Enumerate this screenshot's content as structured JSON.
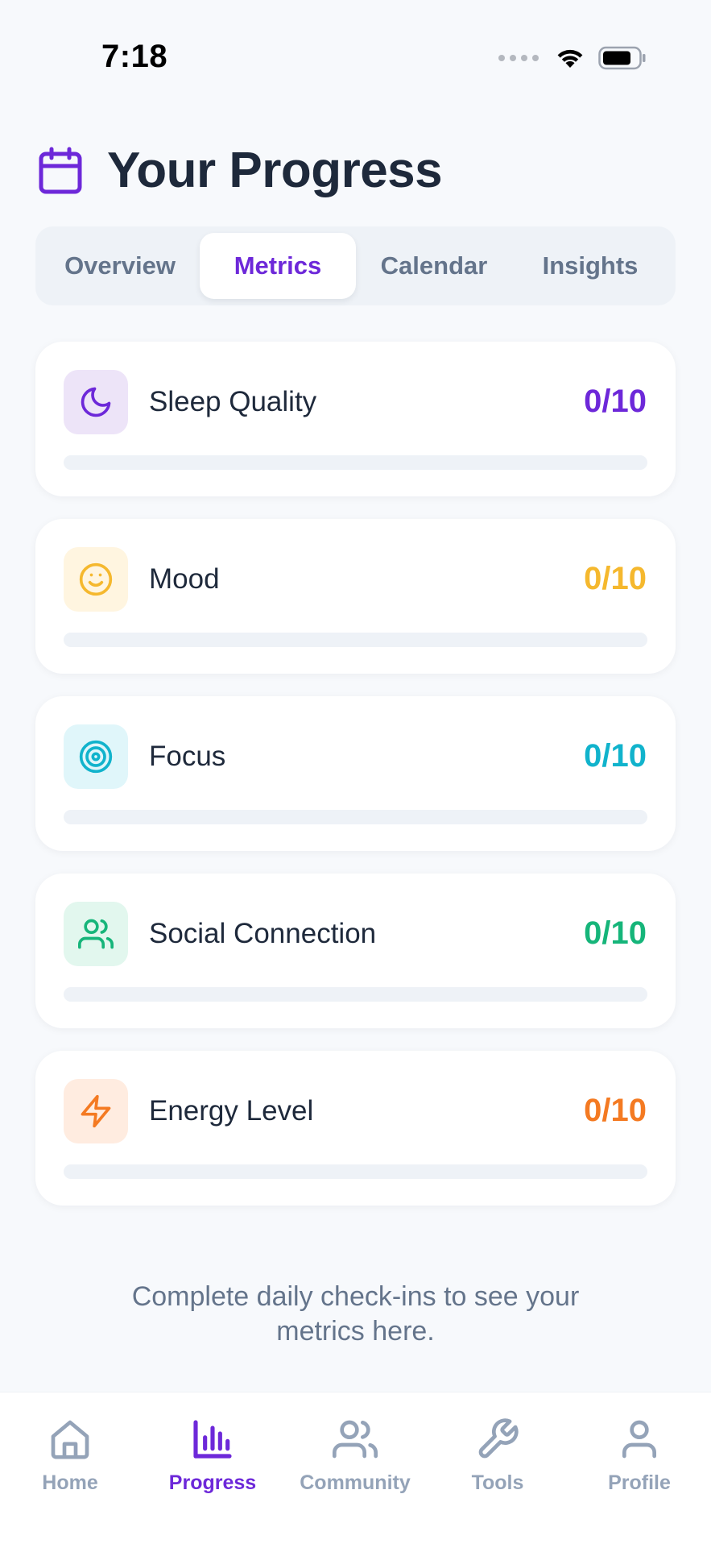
{
  "status_bar": {
    "time": "7:18"
  },
  "header": {
    "title": "Your Progress",
    "icon": "calendar-icon"
  },
  "tabs": [
    {
      "label": "Overview",
      "active": false
    },
    {
      "label": "Metrics",
      "active": true
    },
    {
      "label": "Calendar",
      "active": false
    },
    {
      "label": "Insights",
      "active": false
    }
  ],
  "metrics": [
    {
      "label": "Sleep Quality",
      "value": "0/10",
      "progress": 0,
      "icon": "moon-icon",
      "color": "#6d28d9",
      "bg": "#ede4f8"
    },
    {
      "label": "Mood",
      "value": "0/10",
      "progress": 0,
      "icon": "smile-icon",
      "color": "#f5b82e",
      "bg": "#fff5e0"
    },
    {
      "label": "Focus",
      "value": "0/10",
      "progress": 0,
      "icon": "target-icon",
      "color": "#11b3cc",
      "bg": "#e0f6fa"
    },
    {
      "label": "Social Connection",
      "value": "0/10",
      "progress": 0,
      "icon": "users-icon",
      "color": "#16b57a",
      "bg": "#e2f7ee"
    },
    {
      "label": "Energy Level",
      "value": "0/10",
      "progress": 0,
      "icon": "zap-icon",
      "color": "#f47a22",
      "bg": "#ffece0"
    }
  ],
  "empty_note": "Complete daily check-ins to see your metrics here.",
  "nav": [
    {
      "label": "Home",
      "icon": "home-icon",
      "active": false
    },
    {
      "label": "Progress",
      "icon": "bar-chart-icon",
      "active": true
    },
    {
      "label": "Community",
      "icon": "users-icon",
      "active": false
    },
    {
      "label": "Tools",
      "icon": "wrench-icon",
      "active": false
    },
    {
      "label": "Profile",
      "icon": "user-icon",
      "active": false
    }
  ],
  "colors": {
    "accent": "#6d28d9",
    "inactive": "#94a3b8",
    "background": "#f7f9fc"
  }
}
